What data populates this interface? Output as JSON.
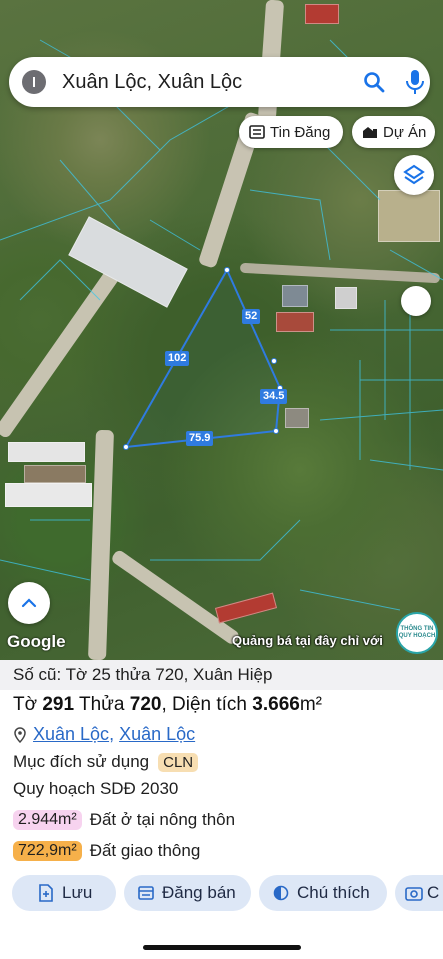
{
  "search": {
    "query": "Xuân Lộc, Xuân Lộc"
  },
  "chips": {
    "tin_dang": "Tin Đăng",
    "du_an": "Dự Án"
  },
  "parcel": {
    "edges": [
      "52",
      "102",
      "34.5",
      "75.9"
    ]
  },
  "map_footer": {
    "google": "Google",
    "ad": "Quảng bá tại đây chỉ với",
    "badge": "THÔNG TIN QUY HOẠCH"
  },
  "panel": {
    "old_number": "Số cũ: Tờ 25 thửa 720, Xuân Hiệp",
    "to_label": "Tờ",
    "to_value": "291",
    "thua_label": "Thửa",
    "thua_value": "720",
    "area_label": "Diện tích",
    "area_value": "3.666",
    "area_unit": "m²",
    "addr_1": "Xuân Lộc",
    "addr_sep": ", ",
    "addr_2": "Xuân Lộc",
    "purpose_label": "Mục đích sử dụng",
    "purpose_code": "CLN",
    "plan_label": "Quy hoạch SDĐ 2030",
    "land_uses": [
      {
        "amount": "2.944m²",
        "name": "Đất ở tại nông thôn",
        "color": "#f7d3ef"
      },
      {
        "amount": "722,9m²",
        "name": "Đất giao thông",
        "color": "#f6b04a"
      }
    ],
    "actions": [
      "Lưu",
      "Đăng bán",
      "Chú thích",
      "C"
    ]
  },
  "colors": {
    "accent": "#2969c7",
    "parcel": "#2f7be0",
    "button_bg": "#dde7f6"
  }
}
